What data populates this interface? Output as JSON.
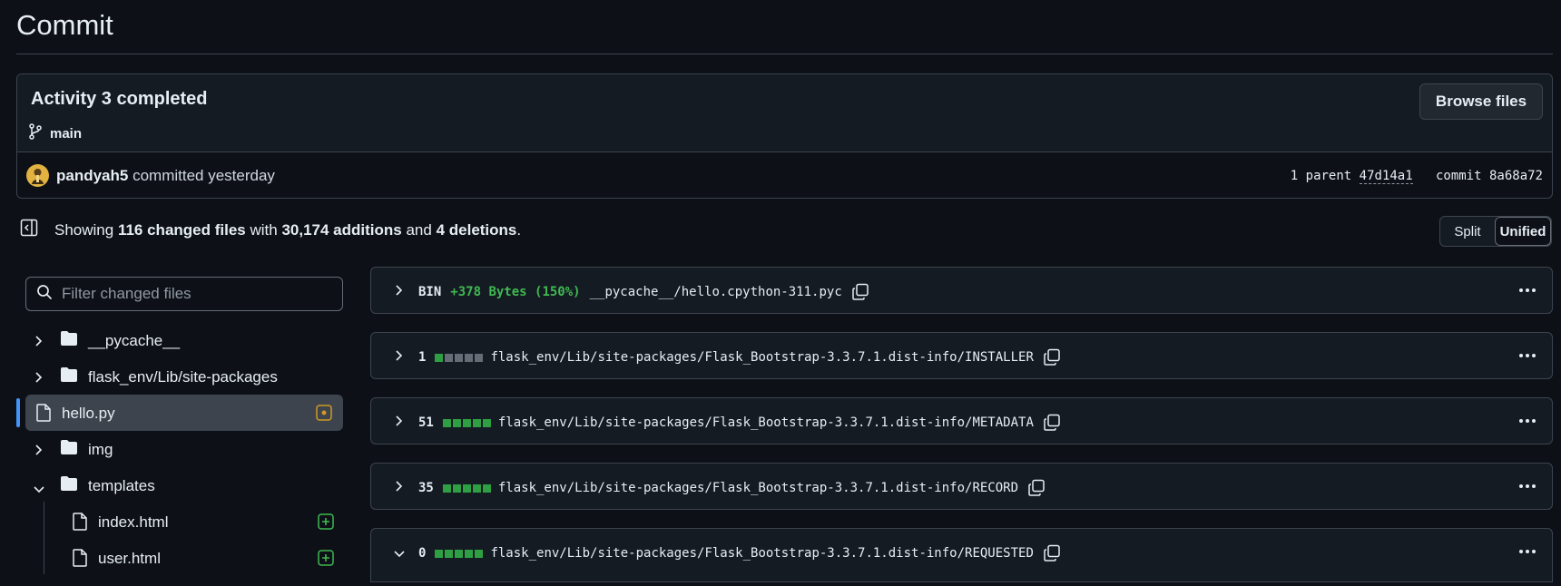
{
  "page": {
    "title": "Commit"
  },
  "commit": {
    "message": "Activity 3 completed",
    "branch": "main",
    "browse_label": "Browse files",
    "author": "pandyah5",
    "action": "committed yesterday",
    "parent_prefix": "1 parent",
    "parent_sha": "47d14a1",
    "commit_prefix": "commit",
    "commit_sha": "8a68a72"
  },
  "summary": {
    "showing": "Showing",
    "changed_files": "116 changed files",
    "with": "with",
    "additions": "30,174 additions",
    "and": "and",
    "deletions": "4 deletions",
    "period": "."
  },
  "view_toggle": {
    "split": "Split",
    "unified": "Unified",
    "active": "Unified"
  },
  "filter": {
    "placeholder": "Filter changed files"
  },
  "tree": {
    "items": [
      {
        "label": "__pycache__",
        "type": "folder",
        "expanded": false
      },
      {
        "label": "flask_env/Lib/site-packages",
        "type": "folder",
        "expanded": false
      },
      {
        "label": "hello.py",
        "type": "file",
        "selected": true,
        "status": "modified"
      },
      {
        "label": "img",
        "type": "folder",
        "expanded": false
      },
      {
        "label": "templates",
        "type": "folder",
        "expanded": true
      },
      {
        "label": "index.html",
        "type": "file",
        "status": "added"
      },
      {
        "label": "user.html",
        "type": "file",
        "status": "added"
      }
    ]
  },
  "diffs": [
    {
      "count": "BIN",
      "bin_change": "+378 Bytes (150%)",
      "path": "__pycache__/hello.cpython-311.pyc",
      "expanded": false
    },
    {
      "count": "1",
      "stat": [
        "g",
        "n",
        "n",
        "n",
        "n"
      ],
      "path": "flask_env/Lib/site-packages/Flask_Bootstrap-3.3.7.1.dist-info/INSTALLER",
      "expanded": false
    },
    {
      "count": "51",
      "stat": [
        "g",
        "g",
        "g",
        "g",
        "g"
      ],
      "path": "flask_env/Lib/site-packages/Flask_Bootstrap-3.3.7.1.dist-info/METADATA",
      "expanded": false
    },
    {
      "count": "35",
      "stat": [
        "g",
        "g",
        "g",
        "g",
        "g"
      ],
      "path": "flask_env/Lib/site-packages/Flask_Bootstrap-3.3.7.1.dist-info/RECORD",
      "expanded": false
    },
    {
      "count": "0",
      "stat": [
        "g",
        "g",
        "g",
        "g",
        "g"
      ],
      "path": "flask_env/Lib/site-packages/Flask_Bootstrap-3.3.7.1.dist-info/REQUESTED",
      "expanded": true
    }
  ],
  "colors": {
    "accent": "#4493f8",
    "added": "#3fb950",
    "modified": "#d29922"
  }
}
